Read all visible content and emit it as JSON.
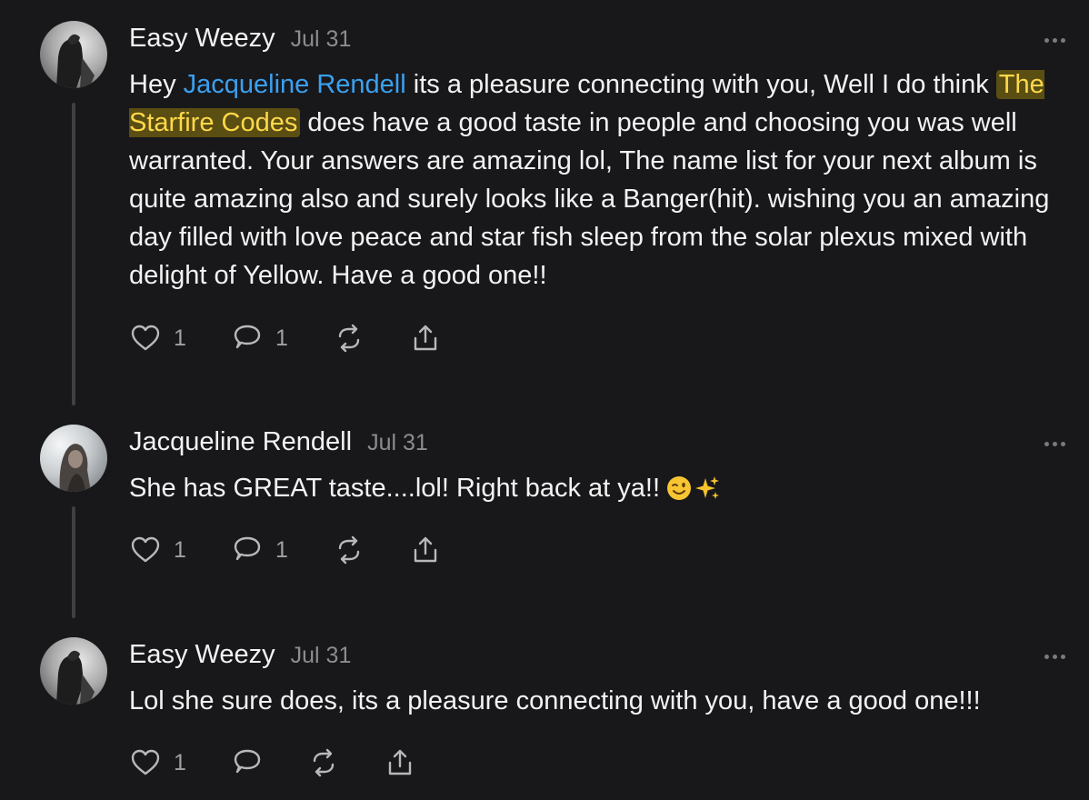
{
  "comments": [
    {
      "author": "Easy Weezy",
      "date": "Jul 31",
      "segments": {
        "prefix": "Hey ",
        "mention": "Jacqueline Rendell",
        "middle": " its a pleasure connecting with you, Well I do think ",
        "highlight": "The Starfire Codes",
        "suffix": " does have a good taste in people and choosing you was well warranted. Your answers are amazing lol, The name list for your next album is quite amazing also and surely looks like a Banger(hit). wishing you an amazing day filled with love peace and star fish sleep from the solar plexus mixed with delight of Yellow. Have a good one!!"
      },
      "likes": "1",
      "replies": "1"
    },
    {
      "author": "Jacqueline Rendell",
      "date": "Jul 31",
      "text": "She has GREAT taste....lol! Right back at ya!!",
      "emoji": [
        "winking-face",
        "sparkles"
      ],
      "likes": "1",
      "replies": "1"
    },
    {
      "author": "Easy Weezy",
      "date": "Jul 31",
      "text": "Lol she sure does, its a pleasure connecting with you, have a good one!!!",
      "likes": "1",
      "replies": ""
    }
  ],
  "icons": [
    "heart-icon",
    "comment-icon",
    "repost-icon",
    "share-icon",
    "more-icon"
  ],
  "colors": {
    "background": "#18181b",
    "text": "#f2f2f2",
    "muted": "#8c8c90",
    "mention": "#3aa0f0",
    "highlight_bg": "#5a4e12",
    "highlight_text": "#ffd84a"
  }
}
